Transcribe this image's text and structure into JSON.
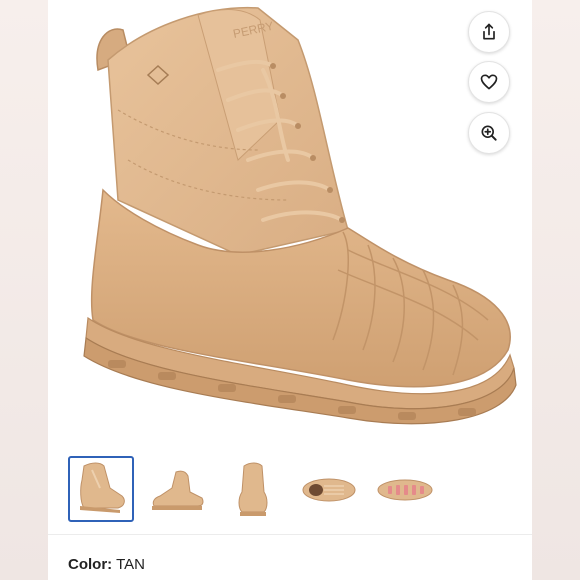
{
  "product": {
    "color_label": "Color:",
    "color_value": "TAN",
    "brand_emboss": "PERRY"
  },
  "actions": [
    {
      "name": "share-button",
      "icon": "share-icon"
    },
    {
      "name": "favorite-button",
      "icon": "heart-icon"
    },
    {
      "name": "zoom-button",
      "icon": "zoom-in-icon"
    }
  ],
  "thumbnails": [
    {
      "view": "three-quarter",
      "selected": true
    },
    {
      "view": "side",
      "selected": false
    },
    {
      "view": "front",
      "selected": false
    },
    {
      "view": "top",
      "selected": false
    },
    {
      "view": "sole",
      "selected": false
    }
  ],
  "colors": {
    "boot_tan": "#e2bb91",
    "boot_shadow": "#c89d72",
    "selected_border": "#2f62b8"
  }
}
